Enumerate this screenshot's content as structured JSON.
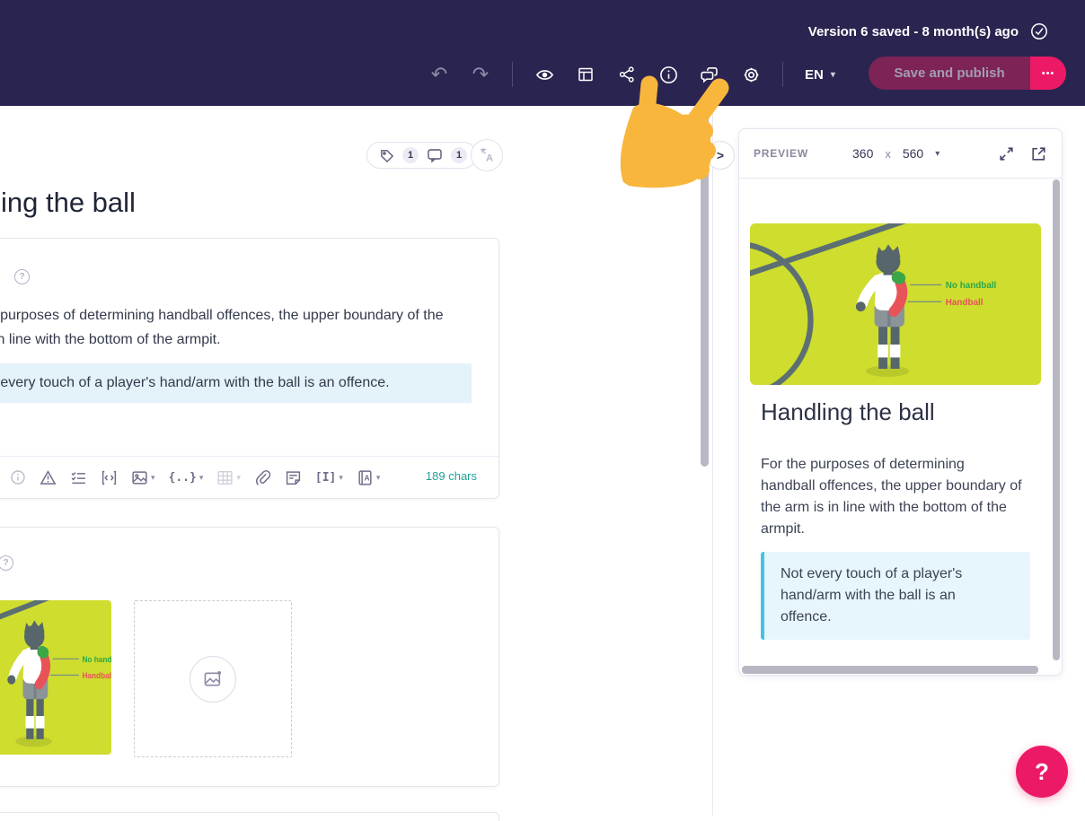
{
  "colors": {
    "topbar_bg": "#2a2450",
    "accent_pink": "#ec1a66",
    "save_muted": "#7d2355",
    "lime_image_bg": "#cedd2e",
    "highlight_blue": "#e4f2fa",
    "callout_bg": "#e7f6fc",
    "callout_border": "#44c3e8",
    "char_count_teal": "#22a29a",
    "hand_yellow": "#f8b63c",
    "label_green": "#2ba84a",
    "label_red": "#e85359"
  },
  "glyphs": {
    "dots": "•••",
    "caret_down": "▾",
    "help_q": "?",
    "chevron_right": ">",
    "undo": "↶",
    "redo": "↷",
    "braces": "{..}",
    "brackets": "[I]",
    "translate": "A",
    "book_letter": "A"
  },
  "header": {
    "version_status": "Version 6 saved - 8 month(s) ago",
    "language": "EN",
    "save_label": "Save and publish"
  },
  "main": {
    "title": "Handling the ball",
    "tag_count": "1",
    "comment_count": "1",
    "editor": {
      "line1": "For the purposes of determining handball offences, the upper boundary of the",
      "line2": "arm is in line with the bottom of the armpit.",
      "highlight": "Not every touch of a player's hand/arm with the ball is an offence.",
      "char_count": "189 chars"
    }
  },
  "preview": {
    "label": "PREVIEW",
    "size_width": "360",
    "size_sep": "x",
    "size_height": "560",
    "slide": {
      "title": "Handling the ball",
      "p_line1": "For the purposes of determining",
      "p_line2": "handball offences, the upper boundary of",
      "p_line3": "the arm is in line with the bottom of the",
      "p_line4": "armpit.",
      "c_line1": "Not every touch of a player's",
      "c_line2": "hand/arm with the ball is an",
      "c_line3": "offence."
    }
  },
  "image": {
    "label_no_handball": "No handball",
    "label_handball": "Handball"
  }
}
